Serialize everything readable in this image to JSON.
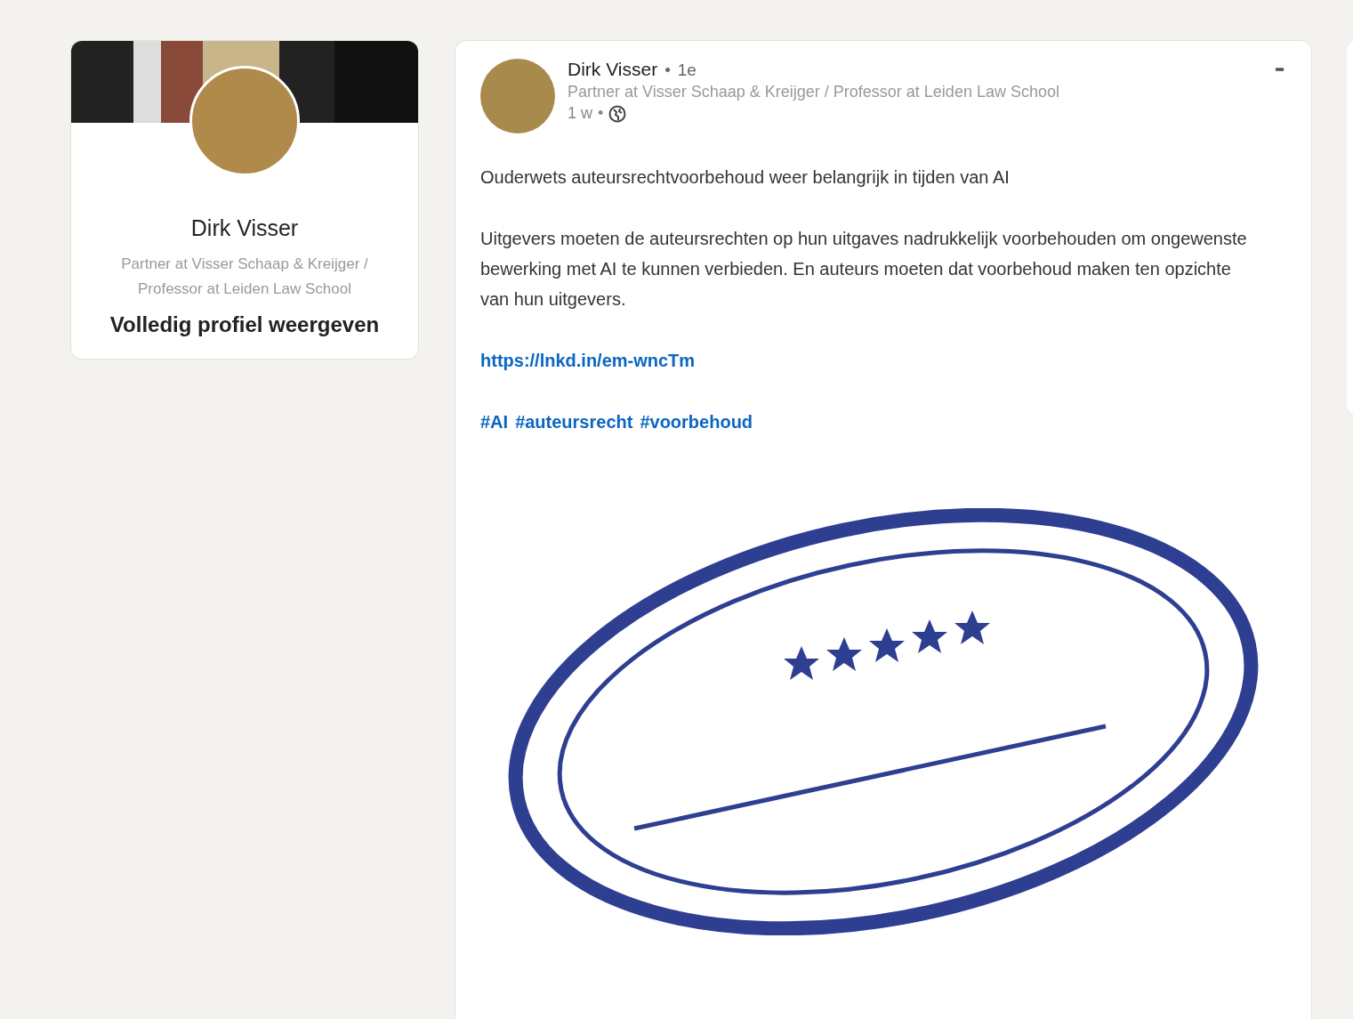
{
  "profile_card": {
    "name": "Dirk Visser",
    "headline": "Partner at Visser Schaap & Kreijger / Professor at Leiden Law School",
    "view_profile": "Volledig profiel weergeven"
  },
  "post": {
    "author": "Dirk Visser",
    "separator": "•",
    "degree": "1e",
    "headline": "Partner at Visser Schaap & Kreijger / Professor at Leiden Law School",
    "age": "1 w",
    "menu": "•••",
    "title": "Ouderwets auteursrechtvoorbehoud weer belangrijk in tijden van AI",
    "body": "Uitgevers moeten de auteursrechten op hun uitgaves nadrukkelijk voorbehouden om ongewenste bewerking met AI te kunnen verbieden. En auteurs moeten dat voorbehoud maken ten opzichte van hun uitgevers.",
    "link": "https://lnkd.in/em-wncTm",
    "hashtags": [
      "#AI",
      "#auteursrecht",
      "#voorbehoud"
    ]
  }
}
